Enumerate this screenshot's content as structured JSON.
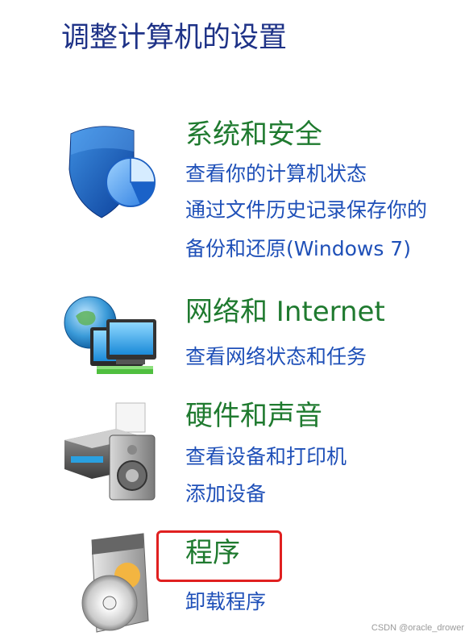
{
  "page": {
    "title": "调整计算机的设置"
  },
  "categories": [
    {
      "id": "system-security",
      "icon": "shield-icon",
      "heading": "系统和安全",
      "links": [
        "查看你的计算机状态",
        "通过文件历史记录保存你的",
        "备份和还原(Windows 7)"
      ]
    },
    {
      "id": "network-internet",
      "icon": "network-globe-icon",
      "heading": "网络和 Internet",
      "links": [
        "查看网络状态和任务"
      ]
    },
    {
      "id": "hardware-sound",
      "icon": "printer-speaker-icon",
      "heading": "硬件和声音",
      "links": [
        "查看设备和打印机",
        "添加设备"
      ]
    },
    {
      "id": "programs",
      "icon": "programs-disc-icon",
      "heading": "程序",
      "links": [
        "卸载程序"
      ]
    }
  ],
  "colors": {
    "title": "#1e3287",
    "heading": "#1f7a2f",
    "link": "#1f50b8",
    "highlight": "#e02020"
  },
  "watermark": "CSDN @oracle_drower"
}
